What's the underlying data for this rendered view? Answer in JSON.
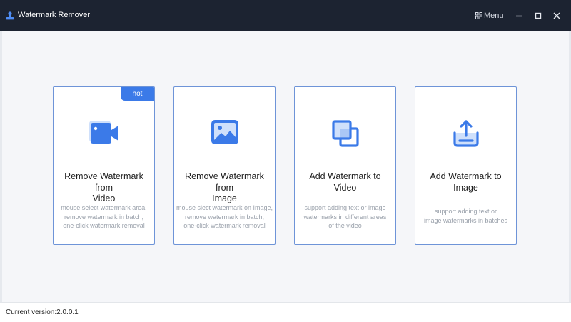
{
  "window": {
    "title": "Watermark Remover",
    "app_icon": "stamp-icon",
    "menu_label": "Menu",
    "menu_icon": "grid-icon",
    "controls": [
      "minimize-icon",
      "maximize-icon",
      "close-icon"
    ]
  },
  "colors": {
    "titlebar": "#1c2331",
    "accent": "#3b7ae8",
    "card_border": "#6e94d8",
    "background": "#f5f6f9",
    "desc_text": "#9aa1ab"
  },
  "cards": [
    {
      "title_line1": "Remove Watermark from",
      "title_line2": "Video",
      "badge": "hot",
      "icon": "video-camera-icon",
      "desc": [
        "mouse select watermark area,",
        "remove watermark in batch,",
        "one-click watermark removal"
      ]
    },
    {
      "title_line1": "Remove Watermark from",
      "title_line2": "Image",
      "icon": "image-icon",
      "desc": [
        "mouse slect watermark on Image,",
        "remove watermark in batch,",
        "one-click watermark removal"
      ]
    },
    {
      "title_line1": "Add Watermark to",
      "title_line2": "Video",
      "icon": "overlap-squares-icon",
      "desc": [
        "support adding text or image",
        "watermarks in different areas",
        "of the video"
      ]
    },
    {
      "title_line1": "Add Watermark to",
      "title_line2": "Image",
      "icon": "upload-tray-icon",
      "desc": [
        "support adding text or",
        "image watermarks in batches"
      ]
    }
  ],
  "footer": {
    "version_text": "Current version:2.0.0.1"
  }
}
